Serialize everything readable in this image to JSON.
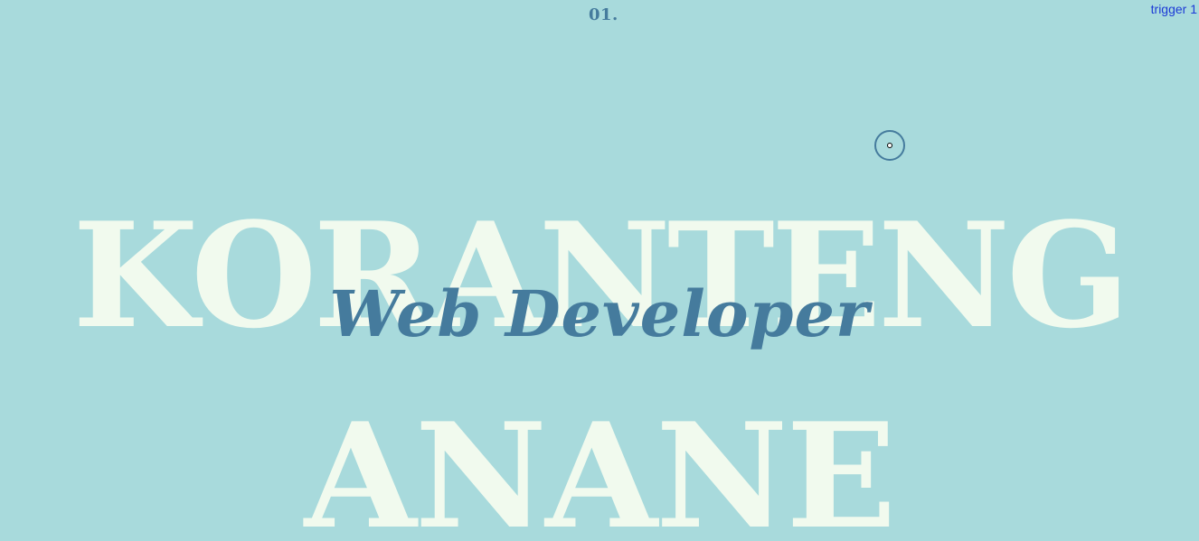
{
  "section": {
    "number": "01."
  },
  "debug": {
    "trigger_label": "trigger 1"
  },
  "hero": {
    "first_name": "KORANTENG",
    "role": "Web Developer",
    "last_name": "ANANE"
  },
  "theme": {
    "background": "#a8dadc",
    "name_color": "#f1faee",
    "accent": "#457b9d",
    "trigger_color": "#1d3bd6"
  },
  "cursor": {
    "icon": "custom-cursor-icon"
  }
}
